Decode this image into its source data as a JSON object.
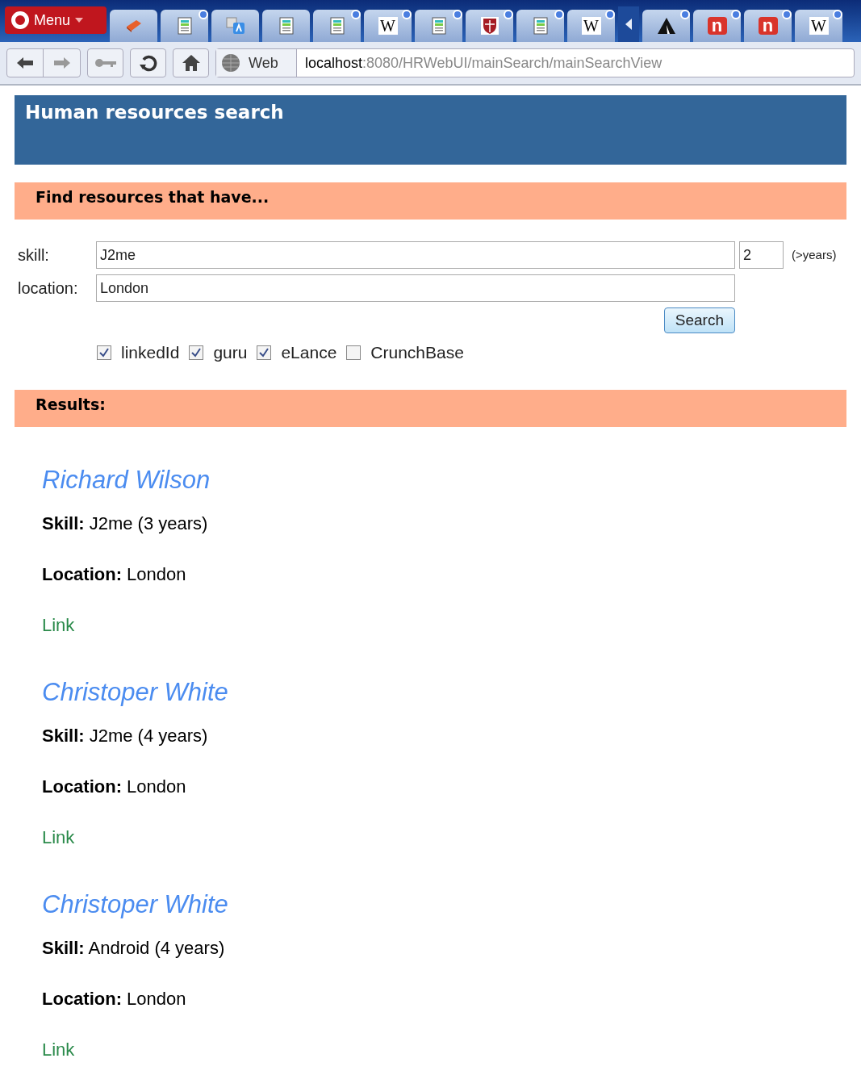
{
  "browser": {
    "menu": "Menu",
    "tabs": [
      {
        "kind": "book",
        "dot": false
      },
      {
        "kind": "page",
        "dot": true
      },
      {
        "kind": "translate",
        "dot": false
      },
      {
        "kind": "page",
        "dot": false
      },
      {
        "kind": "page",
        "dot": true
      },
      {
        "kind": "letter",
        "glyph": "W",
        "dot": true
      },
      {
        "kind": "page",
        "dot": true
      },
      {
        "kind": "shield",
        "dot": true
      },
      {
        "kind": "page",
        "dot": true
      },
      {
        "kind": "letter",
        "glyph": "W",
        "dot": true
      },
      {
        "kind": "arrow"
      },
      {
        "kind": "triangle",
        "dot": true
      },
      {
        "kind": "red-letter",
        "glyph": "n",
        "dot": true
      },
      {
        "kind": "red-letter",
        "glyph": "n",
        "dot": true
      },
      {
        "kind": "letter",
        "glyph": "W",
        "dot": true
      }
    ],
    "search_engine": "Web",
    "url_host": "localhost",
    "url_rest": ":8080/HRWebUI/mainSearch/mainSearchView"
  },
  "page": {
    "title": "Human resources search",
    "find_heading": "Find resources that have...",
    "skill_label": "skill:",
    "skill_value": "J2me",
    "years_value": "2",
    "years_hint": "(>years)",
    "location_label": "location:",
    "location_value": "London",
    "search_button": "Search",
    "sources": [
      {
        "label": "linkedId",
        "checked": true
      },
      {
        "label": "guru",
        "checked": true
      },
      {
        "label": "eLance",
        "checked": true
      },
      {
        "label": "CrunchBase",
        "checked": false
      }
    ],
    "results_heading": "Results:",
    "results": [
      {
        "name": "Richard Wilson",
        "skill": "**Skill:** J2me (3 years)",
        "location": "**Location:** London",
        "link": "Link"
      },
      {
        "name": "Christoper White",
        "skill": "**Skill:** J2me (4 years)",
        "location": "**Location:** London",
        "link": "Link"
      },
      {
        "name": "Christoper White",
        "skill": "**Skill:** Android (4 years)",
        "location": "**Location:** London",
        "link": "Link"
      }
    ]
  }
}
